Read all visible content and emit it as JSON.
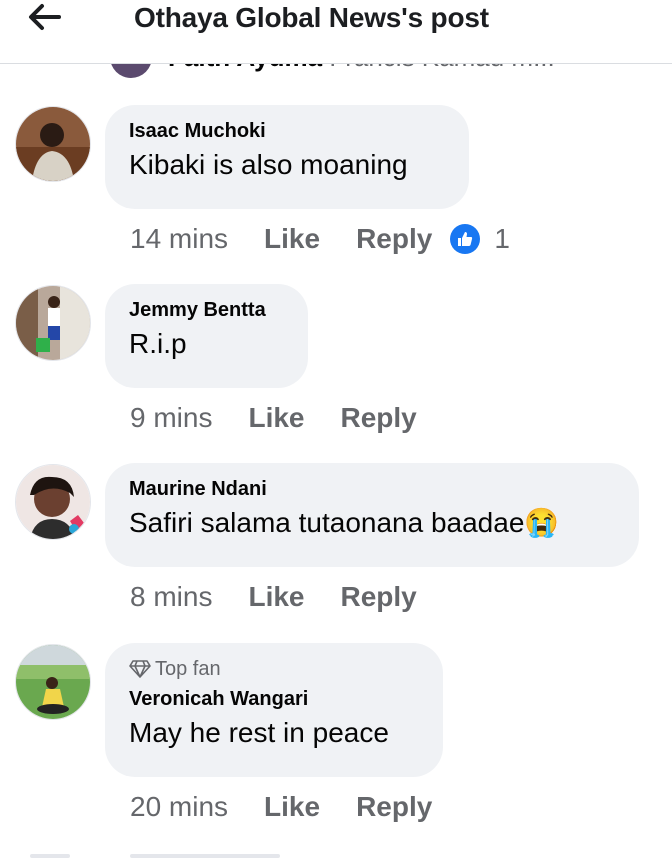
{
  "header": {
    "title": "Othaya Global News's post"
  },
  "peek": {
    "author": "Faith Ayuma",
    "text": "Francis Kamau m..."
  },
  "comments": [
    {
      "author": "Isaac Muchoki",
      "text": "Kibaki is also moaning",
      "time": "14 mins",
      "like": "Like",
      "reply": "Reply",
      "reaction_count": "1"
    },
    {
      "author": "Jemmy Bentta",
      "text": "R.i.p",
      "time": "9 mins",
      "like": "Like",
      "reply": "Reply"
    },
    {
      "author": "Maurine Ndani",
      "text": "Safiri salama tutaonana baadae",
      "emoji": "😭",
      "time": "8 mins",
      "like": "Like",
      "reply": "Reply"
    },
    {
      "badge": "Top fan",
      "author": "Veronicah Wangari",
      "text": "May he rest in peace",
      "time": "20 mins",
      "like": "Like",
      "reply": "Reply"
    }
  ],
  "colors": {
    "bubble": "#f0f2f5",
    "meta": "#65676b",
    "like_blue": "#1877f2"
  },
  "icons": {
    "back": "arrow-left-icon",
    "reaction": "thumbs-up-icon",
    "top_fan": "diamond-icon"
  }
}
